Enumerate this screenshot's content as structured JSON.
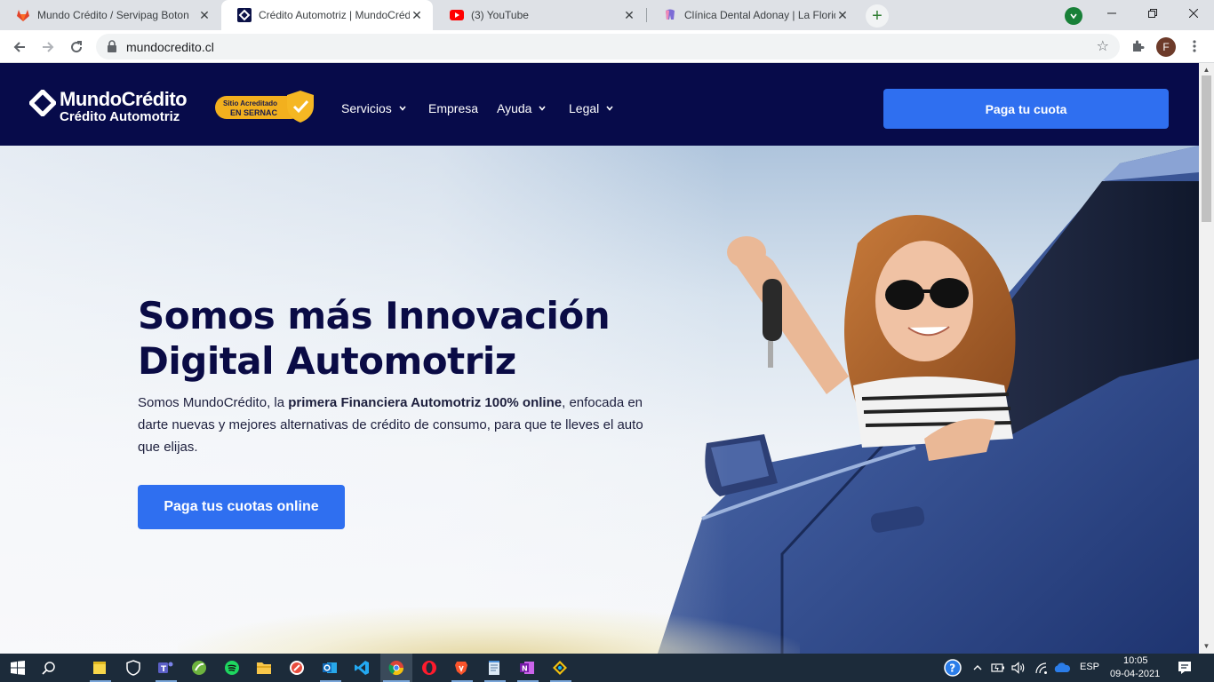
{
  "browser": {
    "tabs": [
      {
        "title": "Mundo Crédito / Servipag Boton",
        "close": "✕"
      },
      {
        "title": "Crédito Automotriz | MundoCrédito",
        "close": "✕"
      },
      {
        "title": "(3) YouTube",
        "close": "✕"
      },
      {
        "title": "Clínica Dental Adonay | La Florida",
        "close": "✕"
      }
    ],
    "new_tab": "+",
    "url": "mundocredito.cl",
    "profile_initial": "F"
  },
  "site": {
    "logo_name": "MundoCrédito",
    "logo_sub": "Crédito Automotriz",
    "badge_line1": "Sitio Acreditado",
    "badge_line2": "EN SERNAC",
    "menu": [
      {
        "label": "Servicios",
        "dropdown": true
      },
      {
        "label": "Empresa",
        "dropdown": false
      },
      {
        "label": "Ayuda",
        "dropdown": true
      },
      {
        "label": "Legal",
        "dropdown": true
      }
    ],
    "header_cta": "Paga tu cuota",
    "hero": {
      "title_line1": "Somos más Innovación",
      "title_line2": "Digital Automotriz",
      "text_pre": "Somos MundoCrédito, la ",
      "text_bold": "primera Financiera Automotriz 100% online",
      "text_post": ", enfocada en darte nuevas y mejores alternativas de crédito de consumo, para que te lleves el auto que elijas.",
      "cta": "Paga tus cuotas online"
    }
  },
  "taskbar": {
    "language": "ESP",
    "time": "10:05",
    "date": "09-04-2021"
  },
  "colors": {
    "header_bg": "#070b4a",
    "accent": "#2f6ff0",
    "title": "#0a0b45",
    "badge": "#f2b01e"
  }
}
